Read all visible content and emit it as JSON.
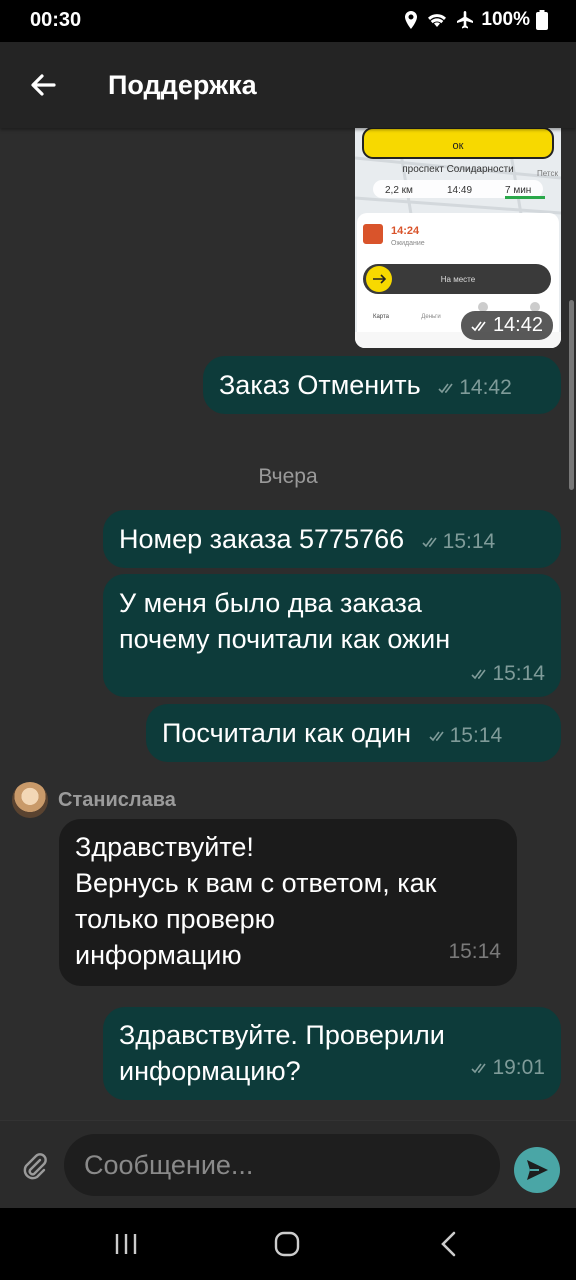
{
  "status": {
    "time": "00:30",
    "battery": "100%"
  },
  "header": {
    "title": "Поддержка"
  },
  "image_message": {
    "time": "14:42",
    "preview": {
      "ok_label": "ок",
      "street": "проспект Солидарности",
      "street_side": "Петск",
      "distance": "2,2 км",
      "eta_time": "14:49",
      "eta_min": "7 мин",
      "order_time": "14:24",
      "order_status": "Ожидание",
      "arrived_label": "На месте",
      "tab_map": "Карта",
      "tab_money": "Деньги"
    }
  },
  "messages": [
    {
      "text": "Заказ Отменить",
      "time": "14:42"
    },
    {
      "text": "Номер  заказа 5775766",
      "time": "15:14"
    },
    {
      "text": "У меня было два заказа почему почитали как ожин",
      "time": "15:14"
    },
    {
      "text": "Посчитали как один",
      "time": "15:14"
    },
    {
      "sender": "Станислава",
      "text_lines": [
        "Здравствуйте!",
        "Вернусь к вам с ответом, как",
        "только проверю",
        "информацию"
      ],
      "time": "15:14"
    },
    {
      "text": "Здравствуйте. Проверили информацию?",
      "time": "19:01"
    }
  ],
  "date_divider": "Вчера",
  "composer": {
    "placeholder": "Сообщение..."
  }
}
